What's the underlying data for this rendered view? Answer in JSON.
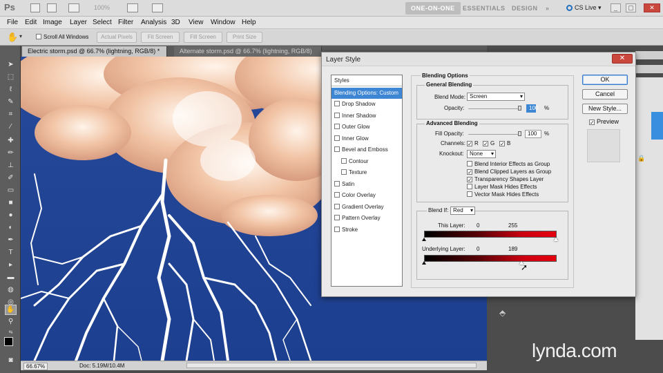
{
  "app": {
    "logo": "Ps",
    "zoom": "100%",
    "workspaces": [
      "ONE-ON-ONE",
      "ESSENTIALS",
      "DESIGN",
      "»"
    ],
    "cslive": "CS Live"
  },
  "menu": [
    "File",
    "Edit",
    "Image",
    "Layer",
    "Select",
    "Filter",
    "Analysis",
    "3D",
    "View",
    "Window",
    "Help"
  ],
  "options": {
    "scroll_all": "Scroll All Windows",
    "actual_pixels": "Actual Pixels",
    "fit_screen": "Fit Screen",
    "fill_screen": "Fill Screen",
    "print_size": "Print Size"
  },
  "tabs": [
    {
      "label": "Electric storm.psd @ 66.7% (lightning, RGB/8) *"
    },
    {
      "label": "Alternate storm.psd @ 66.7% (lightning, RGB/8)"
    }
  ],
  "status": {
    "zoom": "66.67%",
    "doc": "Doc: 5.19M/10.4M"
  },
  "dialog": {
    "title": "Layer Style",
    "styles_header": "Styles",
    "styles_selected": "Blending Options: Custom",
    "styles_items": [
      "Drop Shadow",
      "Inner Shadow",
      "Outer Glow",
      "Inner Glow",
      "Bevel and Emboss",
      "Contour",
      "Texture",
      "Satin",
      "Color Overlay",
      "Gradient Overlay",
      "Pattern Overlay",
      "Stroke"
    ],
    "blending_options": "Blending Options",
    "general_blending": "General Blending",
    "blend_mode_label": "Blend Mode:",
    "blend_mode": "Screen",
    "opacity_label": "Opacity:",
    "opacity": "100",
    "percent": "%",
    "advanced_blending": "Advanced Blending",
    "fill_opacity_label": "Fill Opacity:",
    "fill_opacity": "100",
    "channels_label": "Channels:",
    "channels": [
      "R",
      "G",
      "B"
    ],
    "knockout_label": "Knockout:",
    "knockout": "None",
    "adv_checks": [
      {
        "label": "Blend Interior Effects as Group",
        "on": false
      },
      {
        "label": "Blend Clipped Layers as Group",
        "on": true
      },
      {
        "label": "Transparency Shapes Layer",
        "on": true
      },
      {
        "label": "Layer Mask Hides Effects",
        "on": false
      },
      {
        "label": "Vector Mask Hides Effects",
        "on": false
      }
    ],
    "blend_if_label": "Blend If:",
    "blend_if": "Red",
    "this_layer_label": "This Layer:",
    "this_layer_min": "0",
    "this_layer_max": "255",
    "underlying_label": "Underlying Layer:",
    "underlying_min": "0",
    "underlying_max": "189",
    "ok": "OK",
    "cancel": "Cancel",
    "new_style": "New Style...",
    "preview": "Preview"
  },
  "watermark": "lynda.com"
}
